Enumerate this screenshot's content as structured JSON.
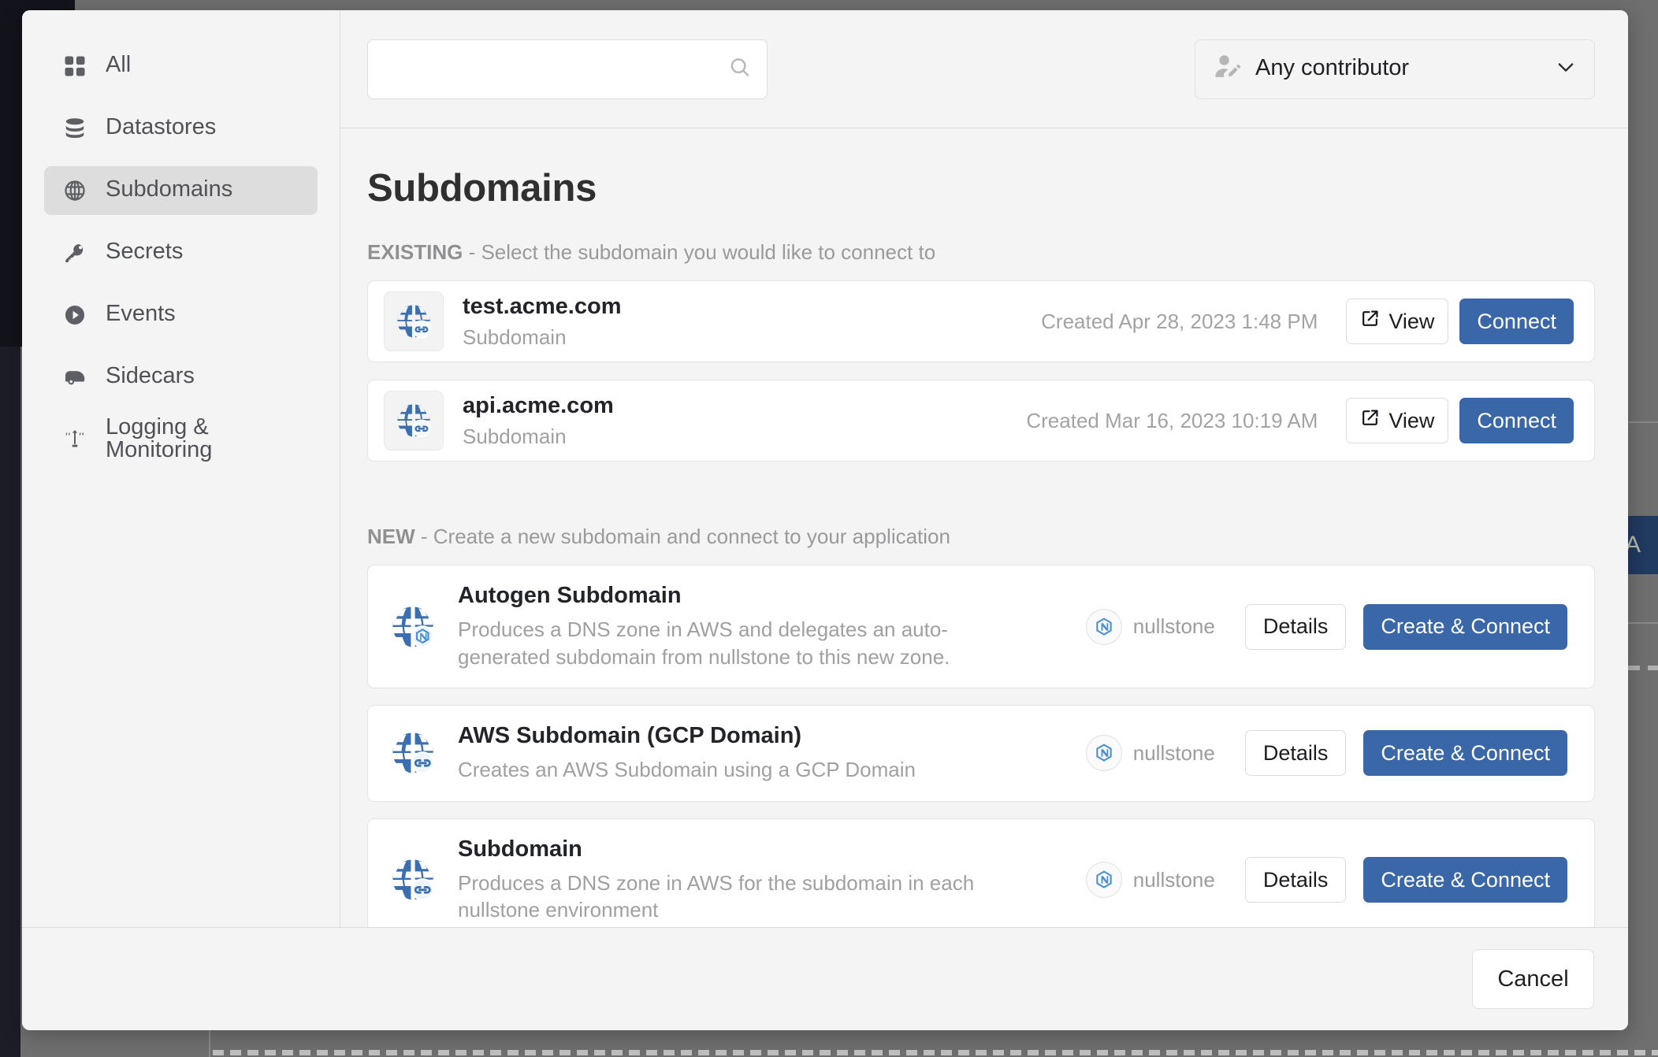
{
  "sidebar": {
    "items": [
      {
        "label": "All",
        "icon": "grid-icon",
        "active": false
      },
      {
        "label": "Datastores",
        "icon": "database-icon",
        "active": false
      },
      {
        "label": "Subdomains",
        "icon": "globe-icon",
        "active": true
      },
      {
        "label": "Secrets",
        "icon": "key-icon",
        "active": false
      },
      {
        "label": "Events",
        "icon": "play-circle-icon",
        "active": false
      },
      {
        "label": "Sidecars",
        "icon": "sidecar-icon",
        "active": false
      },
      {
        "label": "Logging & Monitoring",
        "icon": "antenna-icon",
        "active": false
      }
    ]
  },
  "toolbar": {
    "search": {
      "value": "",
      "placeholder": "",
      "icon": "search-icon"
    },
    "contributor_filter": {
      "label": "Any contributor",
      "icon": "user-edit-icon",
      "chevron": "chevron-down-icon"
    }
  },
  "main": {
    "title": "Subdomains",
    "existing_section": {
      "key": "EXISTING",
      "caption": " - Select the subdomain you would like to connect to",
      "items": [
        {
          "name": "test.acme.com",
          "type": "Subdomain",
          "created": "Created Apr 28, 2023 1:48 PM",
          "icon": "globe-link-icon",
          "view_label": "View",
          "view_icon": "external-link-icon",
          "connect_label": "Connect"
        },
        {
          "name": "api.acme.com",
          "type": "Subdomain",
          "created": "Created Mar 16, 2023 10:19 AM",
          "icon": "globe-link-icon",
          "view_label": "View",
          "view_icon": "external-link-icon",
          "connect_label": "Connect"
        }
      ]
    },
    "new_section": {
      "key": "NEW",
      "caption": " - Create a new subdomain and connect to your application",
      "items": [
        {
          "name": "Autogen Subdomain",
          "description": "Produces a DNS zone in AWS and delegates an auto-generated subdomain from nullstone to this new zone.",
          "icon": "globe-nullstone-icon",
          "contributor": "nullstone",
          "contributor_icon": "nullstone-logo-icon",
          "details_label": "Details",
          "create_label": "Create & Connect"
        },
        {
          "name": "AWS Subdomain (GCP Domain)",
          "description": "Creates an AWS Subdomain using a GCP Domain",
          "icon": "globe-link-icon",
          "contributor": "nullstone",
          "contributor_icon": "nullstone-logo-icon",
          "details_label": "Details",
          "create_label": "Create & Connect"
        },
        {
          "name": "Subdomain",
          "description": "Produces a DNS zone in AWS for the subdomain in each nullstone environment",
          "icon": "globe-link-icon",
          "contributor": "nullstone",
          "contributor_icon": "nullstone-logo-icon",
          "details_label": "Details",
          "create_label": "Create & Connect"
        }
      ]
    }
  },
  "footer": {
    "cancel_label": "Cancel"
  },
  "background": {
    "partial_button_label": "A"
  },
  "colors": {
    "accent_blue": "#3a67a8",
    "icon_blue": "#3b6fb0",
    "modal_bg": "#f4f4f4",
    "card_bg": "#ffffff",
    "active_nav": "#dddddd",
    "muted_text": "#a0a0a2",
    "overlay": "#6f6f6f"
  }
}
